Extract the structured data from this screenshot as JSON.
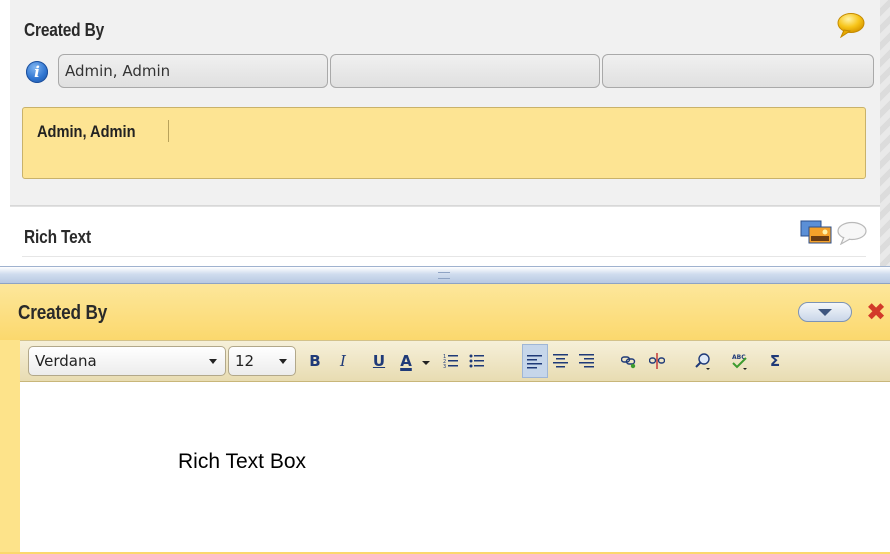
{
  "form": {
    "created_by_title": "Created By",
    "name_fields": [
      "Admin, Admin",
      "",
      ""
    ],
    "selected_value": "Admin, Admin",
    "rich_text_title": "Rich Text"
  },
  "editor": {
    "title": "Created By",
    "font_name": "Verdana",
    "font_size": "12",
    "content_text": "Rich Text Box"
  },
  "toolbar_buttons": {
    "bold": "B",
    "italic": "I",
    "underline": "U",
    "font_color": "A",
    "formula": "Σ"
  },
  "icons": [
    "comment-bubble-icon",
    "info-icon",
    "image-icon",
    "chevron-down-icon",
    "close-icon",
    "numbered-list-icon",
    "bulleted-list-icon",
    "align-left-icon",
    "align-center-icon",
    "align-right-icon",
    "link-icon",
    "unlink-icon",
    "find-icon",
    "spellcheck-icon"
  ],
  "colors": {
    "highlight_yellow": "#fde493",
    "header_yellow": "#fbd86d",
    "toolbar_blue": "#1f3a78",
    "close_red": "#d23a2a",
    "info_blue": "#2f75d1"
  }
}
